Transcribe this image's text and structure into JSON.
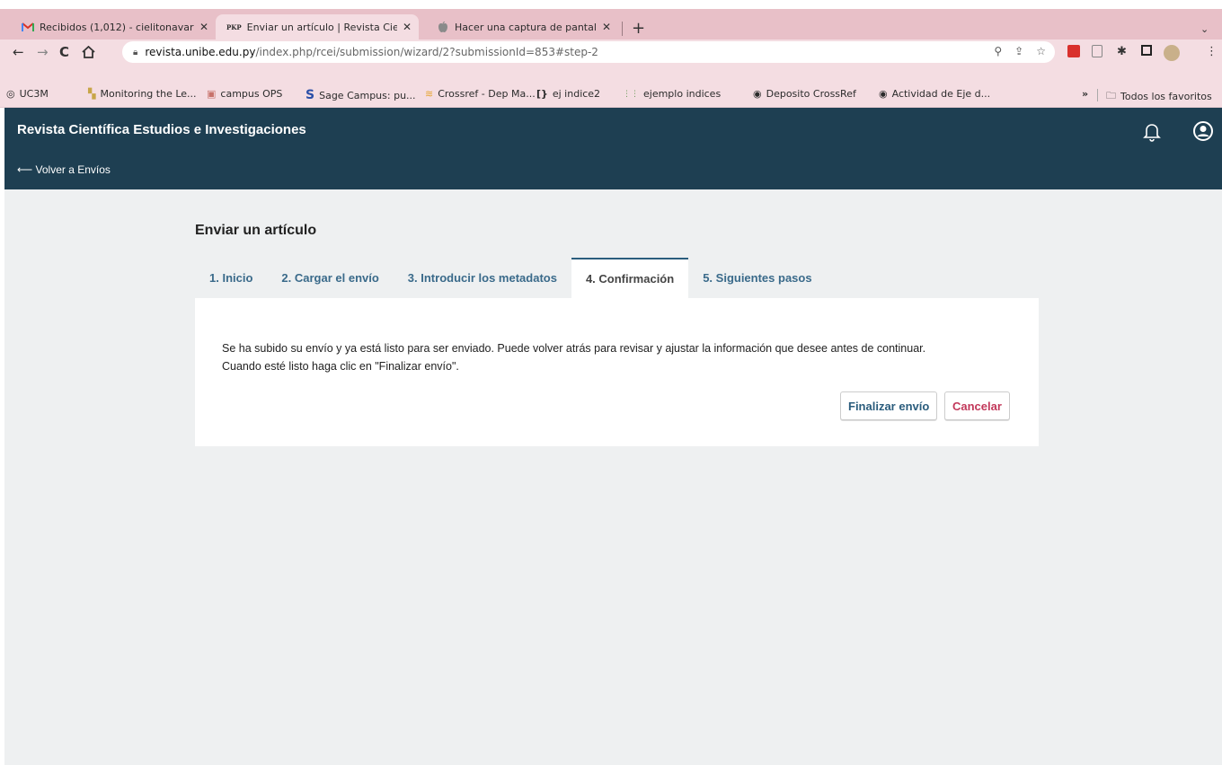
{
  "browser": {
    "tabs": [
      {
        "favicon": "gmail-icon",
        "title": "Recibidos (1,012) - cielitonavar",
        "active": false
      },
      {
        "favicon": "pkp-icon",
        "favicon_text": "PKP",
        "title": "Enviar un artículo | Revista Cie",
        "active": true
      },
      {
        "favicon": "apple-icon",
        "title": "Hacer una captura de pantalla",
        "active": false
      }
    ],
    "url_host": "revista.unibe.edu.py",
    "url_path": "/index.php/rcei/submission/wizard/2?submissionId=853#step-2",
    "bookmarks": [
      {
        "icon": "uc3m-icon",
        "label": "UC3M"
      },
      {
        "icon": "monitoring-icon",
        "label": "Monitoring the Le..."
      },
      {
        "icon": "campus-icon",
        "label": "campus OPS"
      },
      {
        "icon": "sage-icon",
        "label": "Sage Campus: pu..."
      },
      {
        "icon": "crossref-icon",
        "label": "Crossref - Dep Ma..."
      },
      {
        "icon": "bracket-icon",
        "label": "ej indice2"
      },
      {
        "icon": "index-icon",
        "label": "ejemplo indices"
      },
      {
        "icon": "globe-icon",
        "label": "Deposito CrossRef"
      },
      {
        "icon": "globe-icon",
        "label": "Actividad de Eje d..."
      }
    ],
    "bookmarks_overflow": "»",
    "all_bookmarks": "Todos los favoritos"
  },
  "header": {
    "site_title": "Revista Científica Estudios e Investigaciones",
    "back_link": "⟵ Volver a Envíos"
  },
  "main": {
    "heading": "Enviar un artículo",
    "steps": [
      {
        "label": "1. Inicio",
        "active": false
      },
      {
        "label": "2. Cargar el envío",
        "active": false
      },
      {
        "label": "3. Introducir los metadatos",
        "active": false
      },
      {
        "label": "4. Confirmación",
        "active": true
      },
      {
        "label": "5. Siguientes pasos",
        "active": false
      }
    ],
    "message_line1": "Se ha subido su envío y ya está listo para ser enviado. Puede volver atrás para revisar y ajustar la información que desee antes de continuar.",
    "message_line2": "Cuando esté listo haga clic en \"Finalizar envío\".",
    "finish_label": "Finalizar envío",
    "cancel_label": "Cancelar"
  },
  "colors": {
    "header_bg": "#1e3f52",
    "link_blue": "#2b5d7d",
    "cancel_red": "#c2385a",
    "page_bg": "#eef0f1"
  }
}
